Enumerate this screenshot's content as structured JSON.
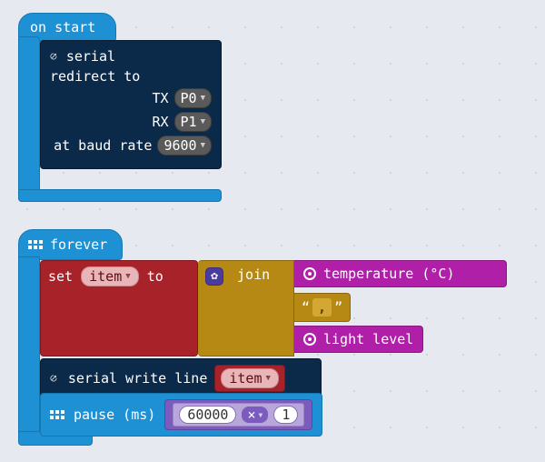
{
  "onstart": {
    "label": "on start",
    "serial": {
      "header_icon": "usb-icon",
      "header": "serial",
      "redirect": "redirect to",
      "tx_label": "TX",
      "tx_value": "P0",
      "rx_label": "RX",
      "rx_value": "P1",
      "baud_label": "at baud rate",
      "baud_value": "9600"
    }
  },
  "forever": {
    "label": "forever",
    "set": {
      "prefix": "set",
      "var": "item",
      "to": "to"
    },
    "join": {
      "label": "join"
    },
    "temperature": "temperature (°C)",
    "comma": ",",
    "light": "light level",
    "swl": {
      "prefix": "serial write line",
      "var": "item"
    },
    "pause": {
      "label": "pause (ms)",
      "left": "60000",
      "op": "×",
      "right": "1"
    }
  }
}
